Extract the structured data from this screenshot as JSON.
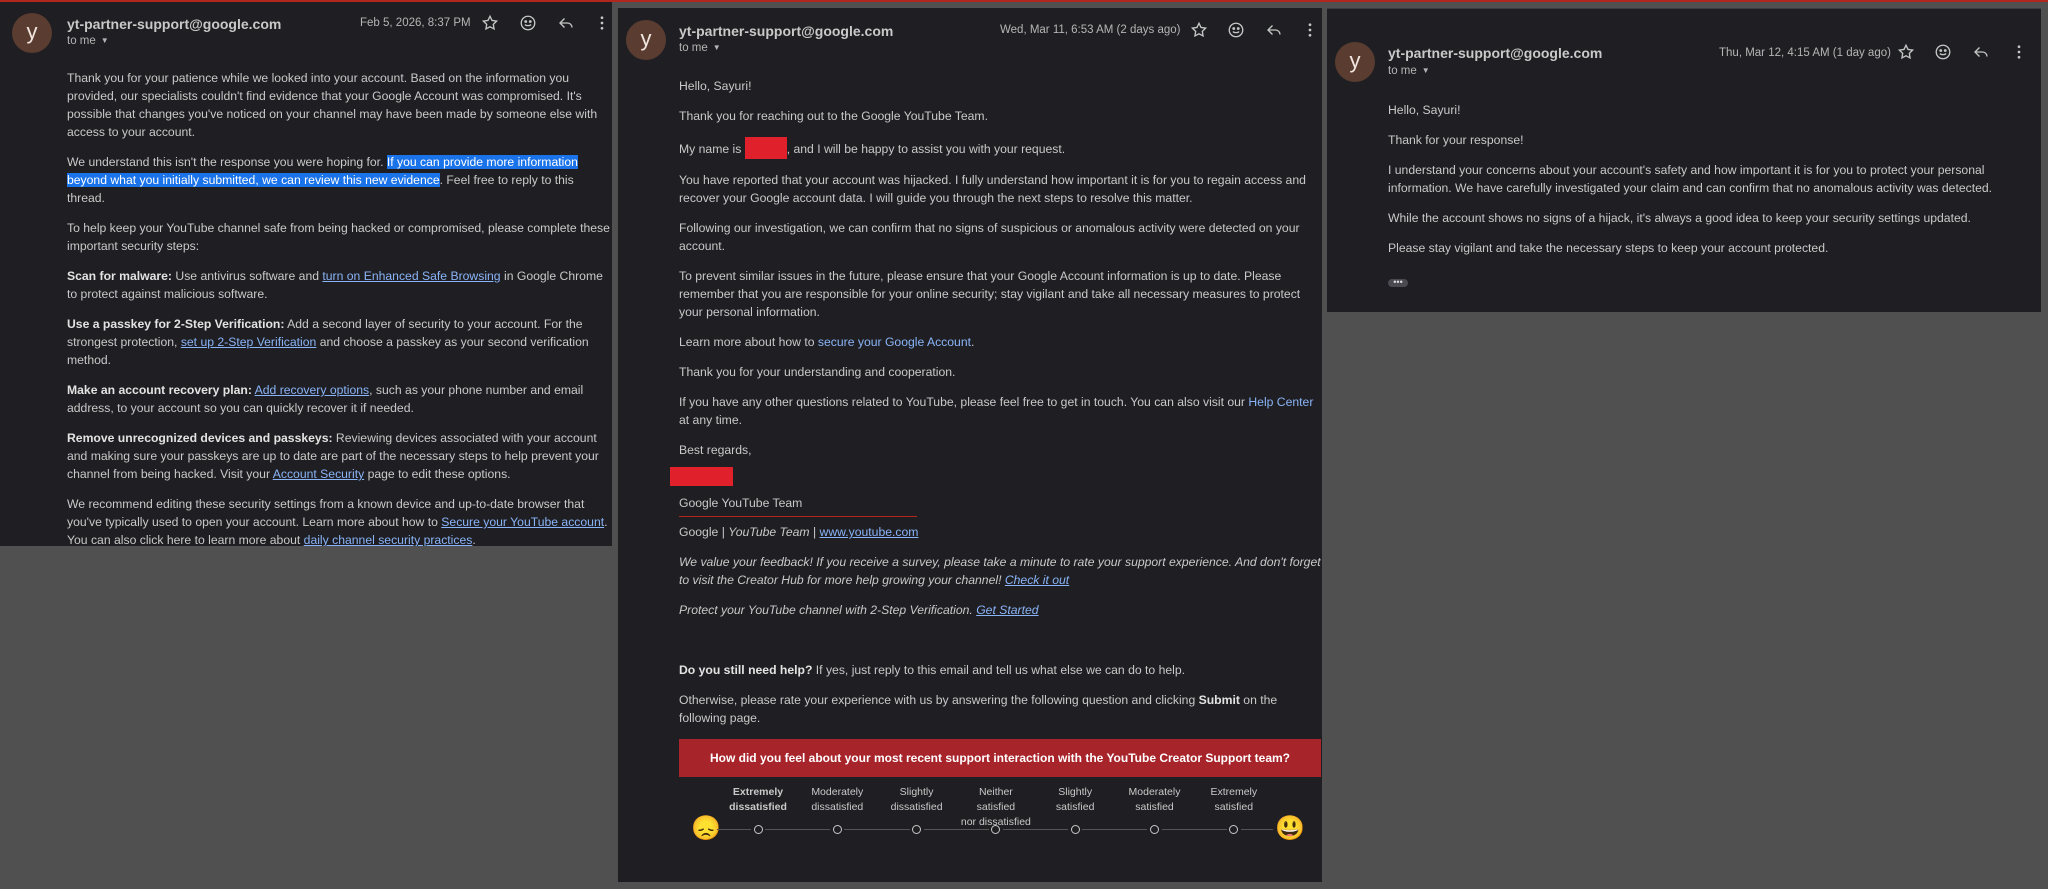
{
  "email1": {
    "avatar_letter": "y",
    "sender": "yt-partner-support@google.com",
    "to": "to me",
    "date": "Feb 5, 2026, 8:37 PM",
    "p1": "Thank you for your patience while we looked into your account. Based on the information you provided, our specialists couldn't find evidence that your Google Account was compromised. It's possible that changes you've noticed on your channel may have been made by someone else with access to your account.",
    "p2_a": "We understand this isn't the response you were hoping for. ",
    "p2_hl": "If you can provide more information beyond what you initially submitted, we can review this new evidence",
    "p2_b": ". Feel free to reply to this thread.",
    "p3": "To help keep your YouTube channel safe from being hacked or compromised, please complete these important security steps:",
    "malware_title": "Scan for malware:",
    "malware_a": " Use antivirus software and ",
    "malware_link": "turn on Enhanced Safe Browsing",
    "malware_b": " in Google Chrome to protect against malicious software.",
    "passkey_title": "Use a passkey for 2-Step Verification:",
    "passkey_a": " Add a second layer of security to your account. For the strongest protection, ",
    "passkey_link": "set up 2-Step Verification",
    "passkey_b": " and choose a passkey as your second verification method.",
    "recovery_title": "Make an account recovery plan:",
    "recovery_a": " ",
    "recovery_link": "Add recovery options",
    "recovery_b": ", such as your phone number and email address, to your account so you can quickly recover it if needed.",
    "devices_title": "Remove unrecognized devices and passkeys:",
    "devices_a": " Reviewing devices associated with your account and making sure your passkeys are up to date are part of the necessary steps to help prevent your channel from being hacked. Visit your ",
    "devices_link": "Account Security",
    "devices_b": " page to edit these options.",
    "rec_a": "We recommend editing these security settings from a known device and up-to-date browser that you've typically used to open your account. Learn more about how to ",
    "rec_link1": "Secure your YouTube account",
    "rec_b": ". You can also click here to learn more about ",
    "rec_link2": "daily channel security practices",
    "rec_c": "."
  },
  "email2": {
    "avatar_letter": "y",
    "sender": "yt-partner-support@google.com",
    "to": "to me",
    "date": "Wed, Mar 11, 6:53 AM (2 days ago)",
    "greeting": "Hello, Sayuri!",
    "p1": "Thank you for reaching out to the Google YouTube Team.",
    "name_a": "My name is ",
    "name_b": ", and I will be happy to assist you with your request.",
    "p3": "You have reported that your account was hijacked. I fully understand how important it is for you to regain access and recover your Google account data. I will guide you through the next steps to resolve this matter.",
    "p4": "Following our investigation, we can confirm that no signs of suspicious or anomalous activity were detected on your account.",
    "p5": "To prevent similar issues in the future, please ensure that your Google Account information is up to date. Please remember that you are responsible for your online security; stay vigilant and take all necessary measures to protect your personal information.",
    "learn_a": "Learn more about how to ",
    "learn_link": "secure your Google Account",
    "learn_b": ".",
    "p7": "Thank you for your understanding and cooperation.",
    "p8_a": "If you have any other questions related to YouTube, please feel free to get in touch. You can also visit our ",
    "p8_link": "Help Center",
    "p8_b": " at any time.",
    "regards": "Best regards,",
    "team": "Google YouTube Team",
    "sig_google": "Google",
    "sig_sep": "|",
    "sig_team": "YouTube Team",
    "sig_link": "www.youtube.com",
    "feedback_a": "We value your feedback! If you receive a survey, please take a minute to rate your support experience. And don't forget to visit the Creator Hub for more help growing your channel! ",
    "feedback_link": "Check it out",
    "protect_a": "Protect your YouTube channel with 2-Step Verification. ",
    "protect_link": "Get Started",
    "help_bold": "Do you still need help?",
    "help_rest": " If yes, just reply to this email and tell us what else we can do to help.",
    "rate_a": "Otherwise, please rate your experience with us by answering the following question and clicking ",
    "rate_bold": "Submit",
    "rate_b": " on the following page.",
    "survey_question": "How did you feel about your most recent support interaction with the YouTube Creator Support team?",
    "scale": [
      [
        "Extremely",
        "dissatisfied"
      ],
      [
        "Moderately",
        "dissatisfied"
      ],
      [
        "Slightly",
        "dissatisfied"
      ],
      [
        "Neither satisfied",
        "nor dissatisfied"
      ],
      [
        "Slightly",
        "satisfied"
      ],
      [
        "Moderately",
        "satisfied"
      ],
      [
        "Extremely",
        "satisfied"
      ]
    ],
    "face_sad": "😞",
    "face_happy": "😃"
  },
  "email3": {
    "avatar_letter": "y",
    "sender": "yt-partner-support@google.com",
    "to": "to me",
    "date": "Thu, Mar 12, 4:15 AM (1 day ago)",
    "greeting": "Hello, Sayuri!",
    "p1": "Thank for your response!",
    "p2": "I understand your concerns about your account's safety and how important it is for you to protect your personal information. We have carefully investigated your claim and can confirm that no anomalous activity was detected.",
    "p3": "While the account shows no signs of a hijack, it's always a good idea to keep your security settings updated.",
    "p4": "Please stay vigilant and take the necessary steps to keep your account protected.",
    "more": "•••"
  },
  "colors": {
    "panel_bg": "#1f1f23",
    "page_bg": "#505050",
    "link": "#8ab4f8",
    "highlight": "#1a73e8",
    "redaction": "#e0202a",
    "survey_banner": "#a8242b"
  },
  "icons": [
    "star-icon",
    "emoji-reaction-icon",
    "reply-icon",
    "more-vert-icon",
    "chevron-down-icon"
  ]
}
